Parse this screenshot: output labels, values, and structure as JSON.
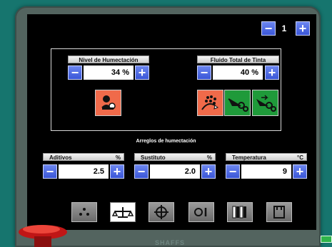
{
  "pager": {
    "minus": "−",
    "page": "1",
    "plus": "+"
  },
  "humidity": {
    "label": "Nivel de Humectación",
    "value": "34 %",
    "minus": "−",
    "plus": "+"
  },
  "ink_fluid": {
    "label": "Fluido Total de Tinta",
    "value": "40 %",
    "minus": "−",
    "plus": "+"
  },
  "settings_title": "Arreglos de humectación",
  "additives": {
    "label": "Aditivos",
    "unit": "%",
    "value": "2.5",
    "minus": "−",
    "plus": "+"
  },
  "substitute": {
    "label": "Sustituto",
    "unit": "%",
    "value": "2.0",
    "minus": "−",
    "plus": "+"
  },
  "temperature": {
    "label": "Temperatura",
    "unit": "°C",
    "value": "9",
    "minus": "−",
    "plus": "+"
  },
  "brand": "SHAFFS",
  "colors": {
    "accent": "#3a56d8",
    "orange": "#f06a4a",
    "green": "#1f9a3a",
    "teal": "#16756e"
  },
  "toolbar_icons": [
    "dots-icon",
    "balance-scale-icon",
    "crosshair-icon",
    "circle-bar-icon",
    "rollers-icon",
    "tray-icon"
  ]
}
